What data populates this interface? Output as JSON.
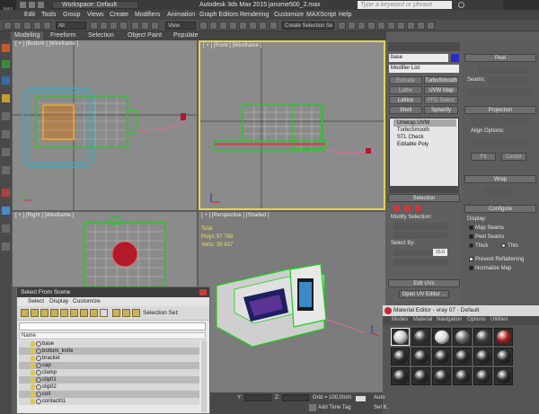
{
  "app": {
    "logo": "MAX"
  },
  "titlebar": {
    "workspace": "Workspace: Default",
    "title": "Autodesk 3ds Max  2015    janome500_2.max",
    "search_placeholder": "Type a keyword or phrase"
  },
  "menu": [
    "Edit",
    "Tools",
    "Group",
    "Views",
    "Create",
    "Modifiers",
    "Animation",
    "Graph Editors",
    "Rendering",
    "Customize",
    "MAXScript",
    "Help"
  ],
  "toolbar": {
    "filter": "All",
    "ref_coord": "View",
    "selection_set": "Create Selection Se"
  },
  "ribbon": {
    "tabs": [
      "Modeling",
      "Freeform",
      "Selection",
      "Object Paint",
      "Populate"
    ],
    "active": "Modeling"
  },
  "viewports": {
    "top_left": "[ + ] [Bottom ] [Wireframe ]",
    "top_right": "[ + ] [Front ] [Wireframe ]",
    "bottom_left": "[ + ] [Right ] [Wireframe ]",
    "bottom_right": "[ + ] [Perspective ] [Shaded ]"
  },
  "stats": {
    "total_label": "Total",
    "polys_label": "Polys:",
    "polys_value": "57 769",
    "verts_label": "Verts:",
    "verts_value": "35 637"
  },
  "command_panel": {
    "object_name": "base",
    "name_color": "#2b2bc8",
    "modifier_list": "Modifier List",
    "buttons": [
      "Extrude",
      "TurboSmooth",
      "Lathe",
      "UVW Map",
      "Lattice",
      "FFD Select",
      "Shell",
      "Spherify"
    ],
    "stack": [
      "Unwrap UVW",
      "TurboSmooth",
      "STL Check",
      "Editable Poly"
    ],
    "selection_title": "Selection",
    "modify_selection": "Modify Selection:",
    "select_by": "Select By:",
    "spinner_value": "15.0",
    "edit_uvs_title": "Edit UVs",
    "open_uv_editor": "Open UV Editor ..."
  },
  "uv_panel": {
    "peel": "Peel",
    "seams": "Seams:",
    "projection": "Projection",
    "align_options": "Align Options:",
    "fit": "Fit",
    "center": "Center",
    "wrap": "Wrap",
    "configure": "Configure",
    "display": "Display:",
    "map_seams": "Map Seams",
    "peel_seams": "Peel Seams",
    "thick": "Thick",
    "thin": "Thin",
    "prevent_reflattening": "Prevent Reflattening",
    "normalize_map": "Normalize Map"
  },
  "select_dialog": {
    "title": "Select From Scene",
    "menu": [
      "Select",
      "Display",
      "Customize"
    ],
    "selection_set": "Selection Set:",
    "column": "Name",
    "items": [
      "base",
      "bottom_knife",
      "bracket",
      "cap",
      "clamp",
      "clip01",
      "clip02",
      "coil",
      "contact01"
    ]
  },
  "material_editor": {
    "title": "Material Editor - vray 07 - Default",
    "menu": [
      "Modes",
      "Material",
      "Navigation",
      "Options",
      "Utilities"
    ],
    "slots": [
      "#c7c7c7",
      "#3a3a3a",
      "#d9d9d9",
      "#6a6a6a",
      "#444444",
      "#b02020",
      "#2a2a2a",
      "#2a2a2a",
      "#2a2a2a",
      "#2a2a2a",
      "#2a2a2a",
      "#2a2a2a",
      "#2a2a2a",
      "#2a2a2a",
      "#2a2a2a",
      "#2a2a2a",
      "#2a2a2a",
      "#2a2a2a"
    ]
  },
  "status": {
    "y_label": "Y:",
    "z_label": "Z:",
    "grid": "Grid = 100,0mm",
    "add_time_tag": "Add Time Tag",
    "auto": "Auto",
    "set_k": "Set K."
  }
}
